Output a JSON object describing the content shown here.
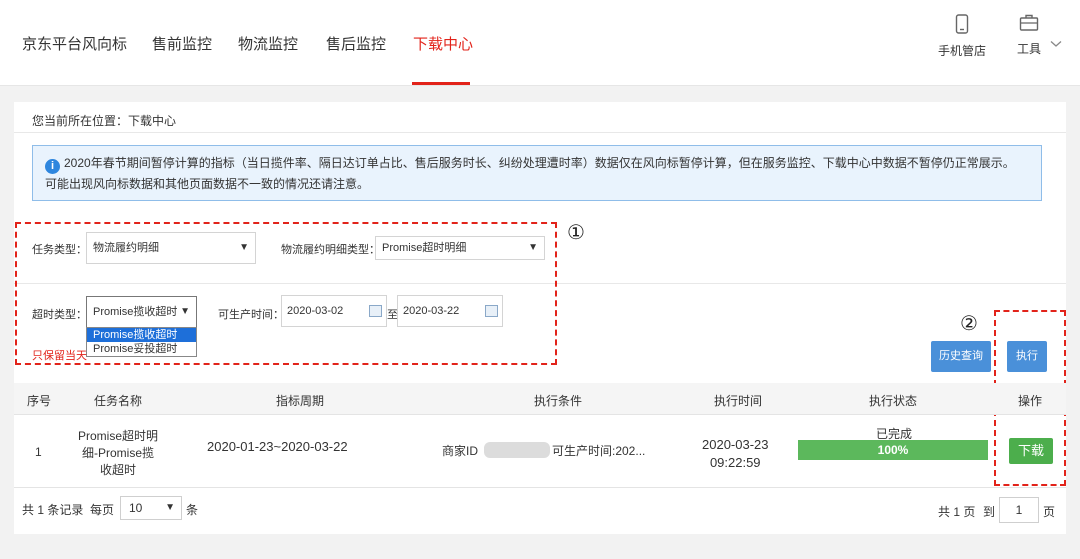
{
  "nav": {
    "items": [
      "京东平台风向标",
      "售前监控",
      "物流监控",
      "售后监控",
      "下载中心"
    ],
    "active": "下载中心",
    "tools": [
      {
        "label": "手机管店",
        "icon": "mobile-icon"
      },
      {
        "label": "工具",
        "icon": "toolbox-icon"
      }
    ],
    "accent_color": "#e2231a"
  },
  "breadcrumb": "您当前所在位置：下载中心",
  "notice": {
    "icon": "info-icon",
    "line1": "2020年春节期间暂停计算的指标（当日揽件率、隔日达订单占比、售后服务时长、纠纷处理遭时率）数据仅在风向标暂停计算，但在服务监控、下载中心中数据不暂停仍正常展示。",
    "line2": "可能出现风向标数据和其他页面数据不一致的情况还请注意。"
  },
  "form": {
    "task_type_label": "任务类型：",
    "task_type_value": "物流履约明细",
    "detail_type_label": "物流履约明细类型：",
    "detail_type_value": "Promise超时明细",
    "timeout_type_label": "超时类型：",
    "timeout_type_value": "Promise揽收超时",
    "timeout_options": [
      "Promise揽收超时",
      "Promise妥投超时"
    ],
    "produce_time_label": "可生产时间：",
    "date_from": "2020-03-02",
    "date_sep": "至",
    "date_to": "2020-03-22",
    "note": "只保留当天"
  },
  "annotations": {
    "one": "①",
    "two": "②"
  },
  "buttons": {
    "history": "历史查询",
    "execute": "执行"
  },
  "table": {
    "headers": [
      "序号",
      "任务名称",
      "指标周期",
      "执行条件",
      "执行时间",
      "执行状态",
      "操作"
    ],
    "rows": [
      {
        "index": "1",
        "name_line1": "Promise超时明",
        "name_line2": "细-Promise揽",
        "name_line3": "收超时",
        "period": "2020-01-23~2020-03-22",
        "cond_prefix": "商家ID",
        "cond_suffix": "可生产时间:202...",
        "exec_date": "2020-03-23",
        "exec_time": "09:22:59",
        "status": "已完成",
        "progress_label": "100%",
        "progress": 1.0,
        "action": "下载"
      }
    ]
  },
  "pagination": {
    "total_text": "共 1 条记录",
    "per_page_label": "每页",
    "per_page": "10",
    "unit": "条",
    "pages_text": "共 1 页",
    "goto_label": "到",
    "page_input": "1",
    "page_unit": "页"
  }
}
